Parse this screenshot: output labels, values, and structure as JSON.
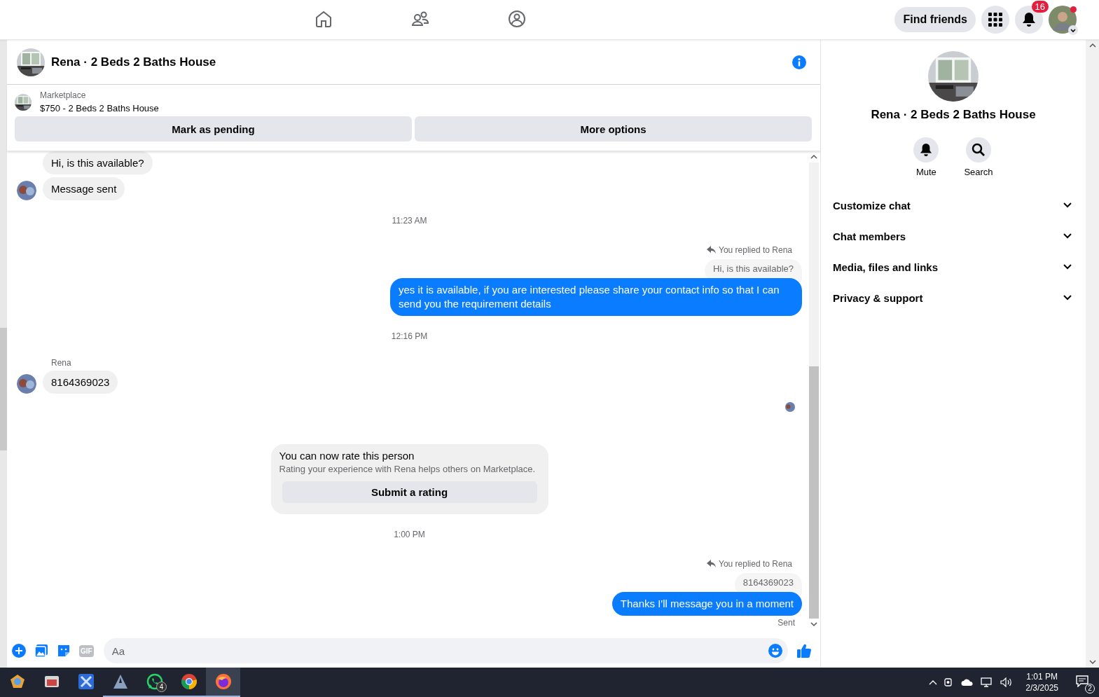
{
  "top_nav": {
    "tabs": [
      {
        "kind": "home",
        "selected": false
      },
      {
        "kind": "friends",
        "selected": false
      },
      {
        "kind": "groups",
        "selected": false
      }
    ],
    "find_friends": "Find friends",
    "notification_count": "16"
  },
  "chat": {
    "title": "Rena · 2 Beds 2 Baths House",
    "listing": {
      "source": "Marketplace",
      "title": "$750 - 2 Beds 2 Baths House"
    },
    "actions": [
      "Mark as pending",
      "More options"
    ],
    "messages": [
      {
        "kind": "incoming",
        "text": "Hi, is this available?",
        "avatar": false
      },
      {
        "kind": "incoming",
        "text": "Message sent",
        "avatar": true
      },
      {
        "kind": "time",
        "text": "11:23 AM"
      },
      {
        "kind": "reply",
        "label": "You replied to Rena",
        "quoted": "Hi, is this available?",
        "text": "yes it is available, if you are interested please share your contact info so that I can send you the requirement details"
      },
      {
        "kind": "time",
        "text": "12:16 PM"
      },
      {
        "kind": "incoming",
        "sender": "Rena",
        "text": "8164369023",
        "avatar": true
      },
      {
        "kind": "seen"
      },
      {
        "kind": "rating",
        "title": "You can now rate this person",
        "body": "Rating your experience with Rena helps others on Marketplace.",
        "button": "Submit a rating"
      },
      {
        "kind": "time",
        "text": "1:00 PM"
      },
      {
        "kind": "reply",
        "label": "You replied to Rena",
        "quoted": "8164369023",
        "text": "Thanks I'll message you in a moment",
        "status": "Sent"
      }
    ],
    "composer": {
      "gif_label": "GIF",
      "placeholder": "Aa"
    }
  },
  "info": {
    "title": "Rena · 2 Beds 2 Baths House",
    "actions": [
      {
        "kind": "bell",
        "label": "Mute"
      },
      {
        "kind": "search",
        "label": "Search"
      }
    ],
    "sections": [
      {
        "label": "Customize chat",
        "expanded": false
      },
      {
        "label": "Chat members",
        "expanded": false
      },
      {
        "label": "Media, files and links",
        "expanded": false
      },
      {
        "label": "Privacy & support",
        "expanded": false
      }
    ]
  },
  "taskbar": {
    "apps": [
      {
        "kind": "photos",
        "running": false,
        "selected": false
      },
      {
        "kind": "files",
        "running": false,
        "selected": false
      },
      {
        "kind": "editor",
        "running": false,
        "selected": false
      },
      {
        "kind": "game",
        "running": true,
        "selected": false
      },
      {
        "kind": "whatsapp",
        "running": true,
        "selected": false,
        "badge": "4"
      },
      {
        "kind": "chrome",
        "running": true,
        "selected": false
      },
      {
        "kind": "firefox",
        "running": true,
        "selected": true
      }
    ],
    "time": "1:01 PM",
    "date": "2/3/2025",
    "notification_count": "2"
  }
}
